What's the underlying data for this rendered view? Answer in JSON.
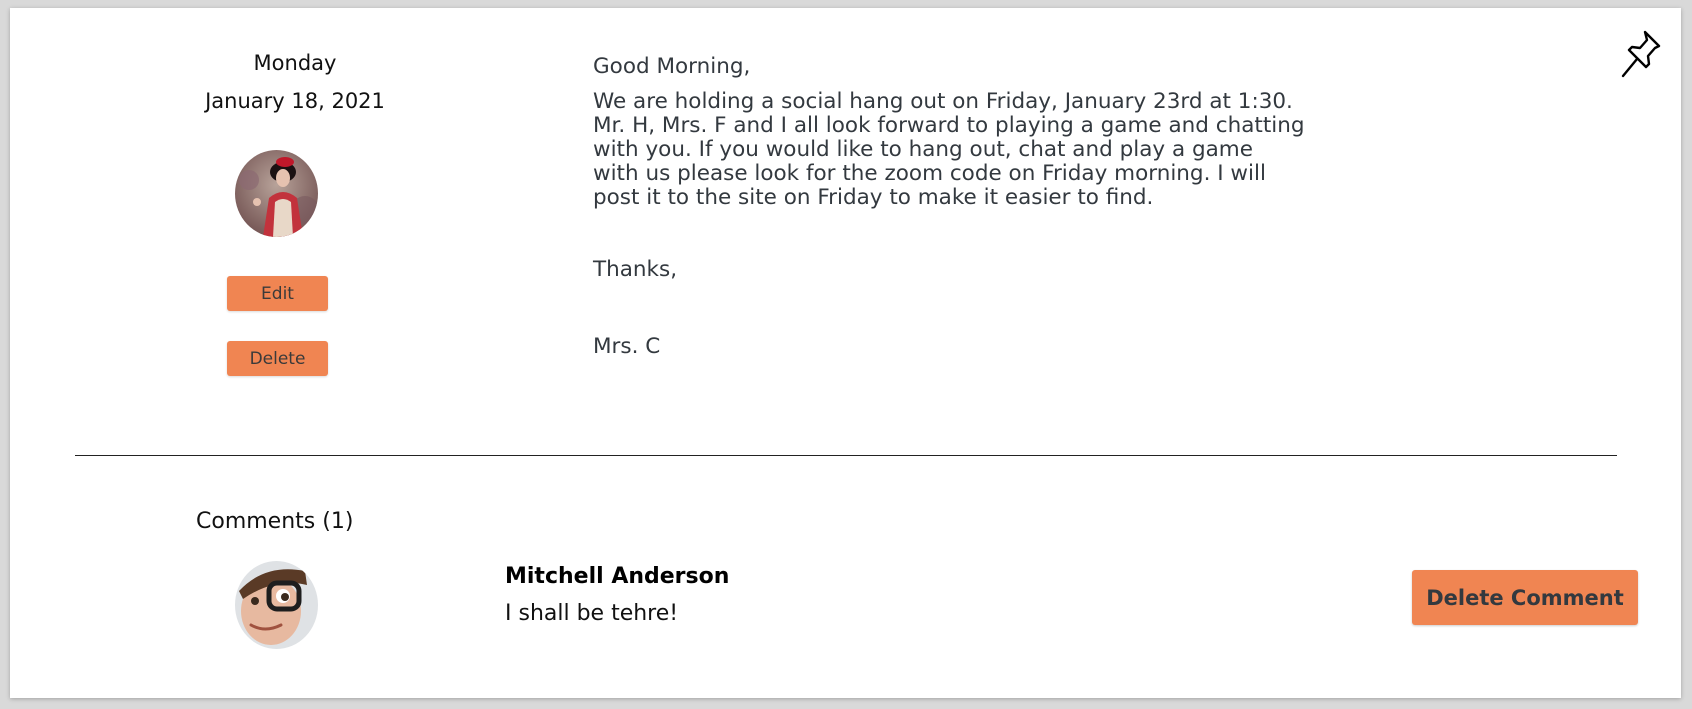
{
  "post": {
    "day": "Monday",
    "date": "January 18, 2021",
    "greeting": "Good Morning,",
    "body": "We are holding a social hang out on Friday, January 23rd at 1:30.\nMr. H, Mrs. F and I all look forward to playing a game and chatting\nwith you.  If you would like to hang out, chat and play a game\nwith us please look for the zoom code on Friday morning.  I will\npost it to the site on Friday to make it easier to find.",
    "thanks": "Thanks,",
    "signature": "Mrs. C",
    "edit_label": "Edit",
    "delete_label": "Delete"
  },
  "comments": {
    "heading": "Comments (1)",
    "items": [
      {
        "author": "Mitchell Anderson",
        "text": "I shall be tehre!",
        "delete_label": "Delete Comment"
      }
    ]
  },
  "icons": {
    "pin": "pushpin-icon",
    "author_avatar": "avatar",
    "commenter_avatar": "avatar"
  },
  "colors": {
    "accent": "#f08552",
    "text": "#33393f"
  }
}
